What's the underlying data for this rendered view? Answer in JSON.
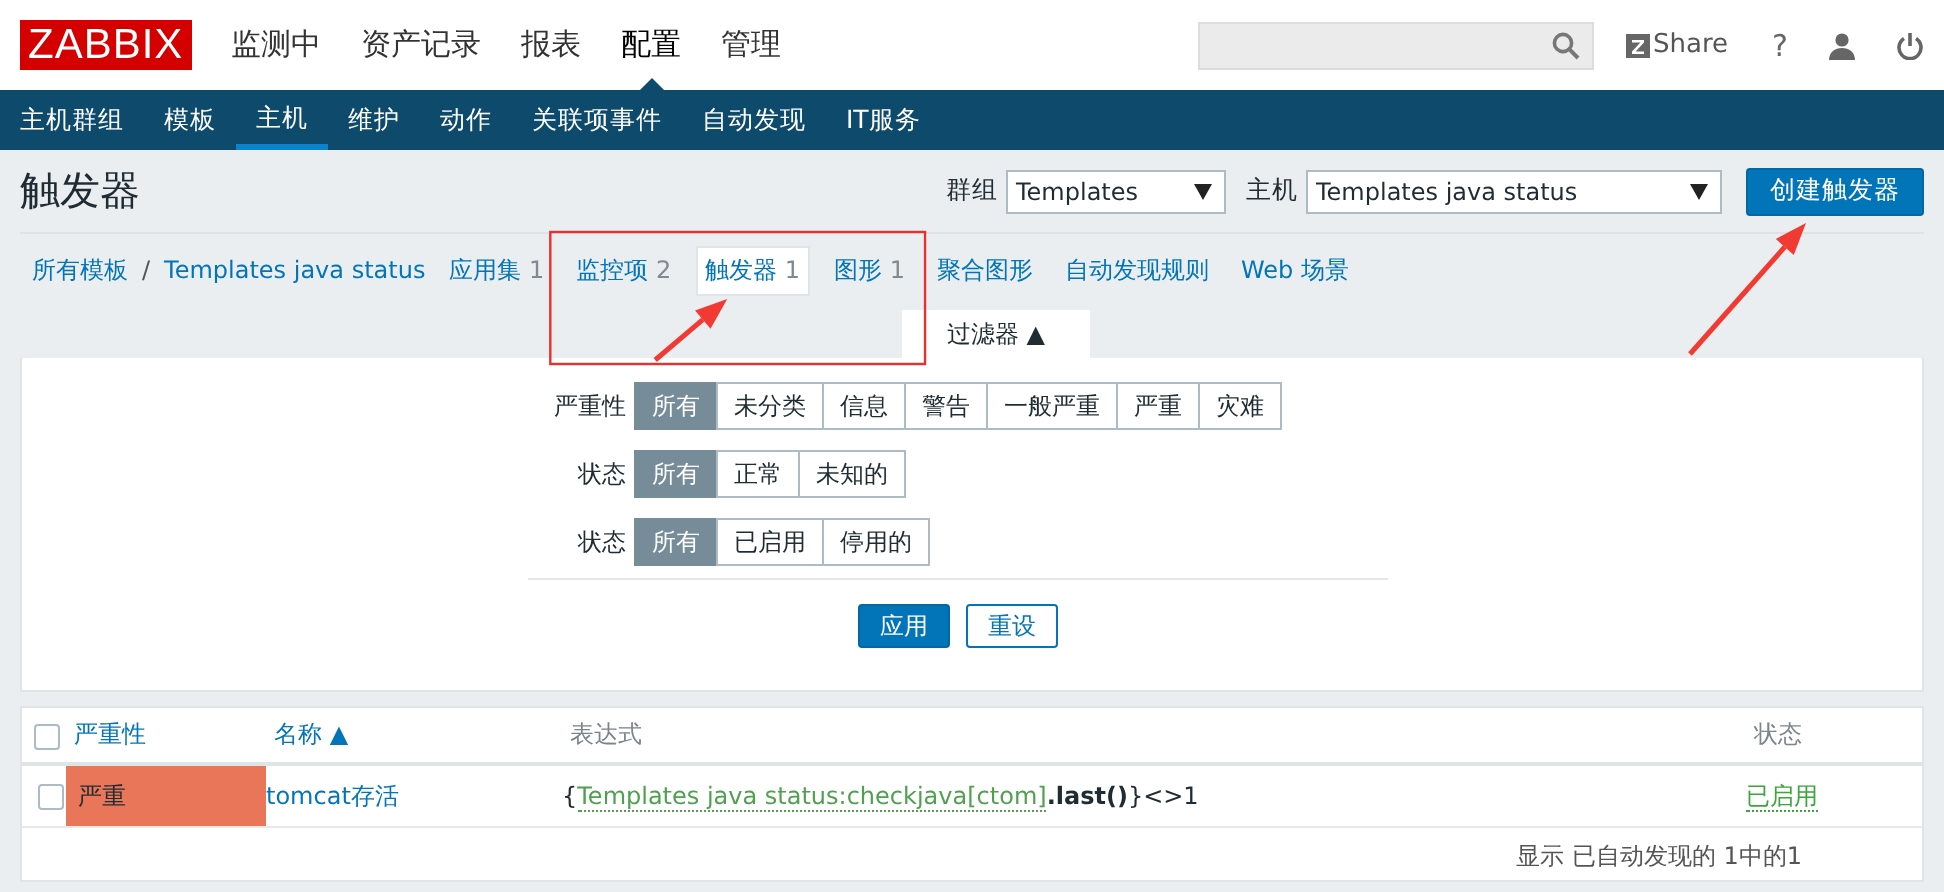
{
  "header": {
    "logo": "ZABBIX",
    "menu": [
      {
        "label": "监测中",
        "selected": false
      },
      {
        "label": "资产记录",
        "selected": false
      },
      {
        "label": "报表",
        "selected": false
      },
      {
        "label": "配置",
        "selected": true
      },
      {
        "label": "管理",
        "selected": false
      }
    ],
    "share": "Share",
    "help": "?"
  },
  "submenu": [
    {
      "label": "主机群组",
      "selected": false
    },
    {
      "label": "模板",
      "selected": false
    },
    {
      "label": "主机",
      "selected": true
    },
    {
      "label": "维护",
      "selected": false
    },
    {
      "label": "动作",
      "selected": false
    },
    {
      "label": "关联项事件",
      "selected": false
    },
    {
      "label": "自动发现",
      "selected": false
    },
    {
      "label": "IT服务",
      "selected": false
    }
  ],
  "page": {
    "title": "触发器",
    "group_label": "群组",
    "group_value": "Templates",
    "host_label": "主机",
    "host_value": "Templates java status",
    "create_button": "创建触发器"
  },
  "breadcrumb": [
    {
      "label": "所有模板"
    },
    {
      "label": "Templates java status"
    }
  ],
  "breadcrumb_separator": "/",
  "tabs": [
    {
      "label": "应用集",
      "count": "1",
      "selected": false
    },
    {
      "label": "监控项",
      "count": "2",
      "selected": false
    },
    {
      "label": "触发器",
      "count": "1",
      "selected": true
    },
    {
      "label": "图形",
      "count": "1",
      "selected": false
    },
    {
      "label": "聚合图形",
      "selected": false
    },
    {
      "label": "自动发现规则",
      "selected": false
    },
    {
      "label": "Web 场景",
      "selected": false
    }
  ],
  "filter": {
    "tab": "过滤器 ▲",
    "rows": [
      {
        "label": "严重性",
        "options": [
          {
            "label": "所有",
            "selected": true
          },
          {
            "label": "未分类",
            "selected": false
          },
          {
            "label": "信息",
            "selected": false
          },
          {
            "label": "警告",
            "selected": false
          },
          {
            "label": "一般严重",
            "selected": false
          },
          {
            "label": "严重",
            "selected": false
          },
          {
            "label": "灾难",
            "selected": false
          }
        ]
      },
      {
        "label": "状态",
        "options": [
          {
            "label": "所有",
            "selected": true
          },
          {
            "label": "正常",
            "selected": false
          },
          {
            "label": "未知的",
            "selected": false
          }
        ]
      },
      {
        "label": "状态",
        "options": [
          {
            "label": "所有",
            "selected": true
          },
          {
            "label": "已启用",
            "selected": false
          },
          {
            "label": "停用的",
            "selected": false
          }
        ]
      }
    ],
    "apply": "应用",
    "reset": "重设"
  },
  "table": {
    "columns": [
      {
        "label": "严重性",
        "link": true
      },
      {
        "label": "名称 ▲",
        "link": true
      },
      {
        "label": "表达式",
        "link": false
      },
      {
        "label": "状态",
        "link": false
      }
    ],
    "header_checked": false,
    "rows": [
      {
        "checked": false,
        "severity": "严重",
        "color": "#e97659",
        "name": "tomcat存活",
        "expression": [
          {
            "kind": "plain",
            "text": "{"
          },
          {
            "kind": "item",
            "text": "Templates java status:checkjava[ctom]"
          },
          {
            "kind": "function",
            "text": ".last()"
          },
          {
            "kind": "plain",
            "text": "}<>1"
          }
        ],
        "status": "已启用",
        "enabled": true
      }
    ],
    "footer": "显示 已自动发现的 1中的1"
  },
  "annotations": [
    {
      "kind": "frame"
    },
    {
      "kind": "arrow"
    },
    {
      "kind": "arrow"
    }
  ]
}
